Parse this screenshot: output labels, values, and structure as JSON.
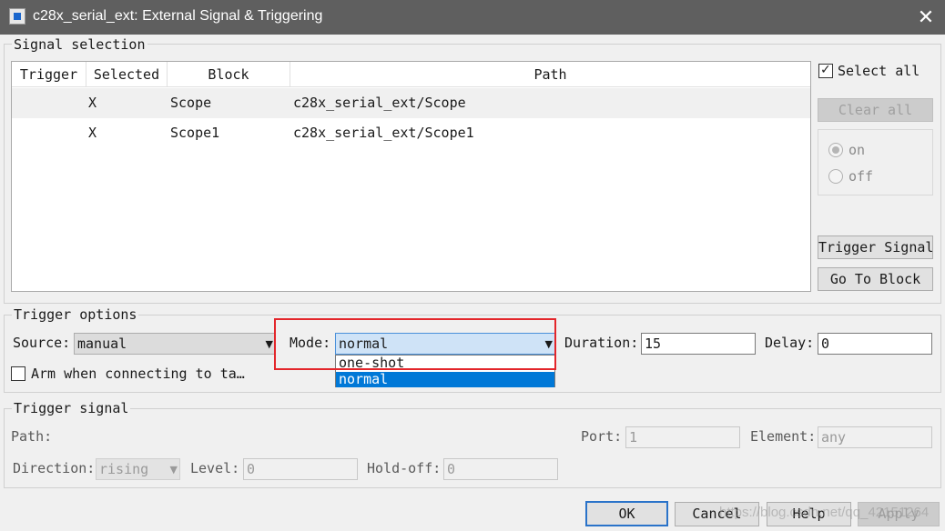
{
  "window": {
    "title": "c28x_serial_ext: External Signal & Triggering",
    "close_label": "✕"
  },
  "signal_selection": {
    "label": "Signal selection",
    "columns": [
      "Trigger",
      "Selected",
      "Block",
      "Path"
    ],
    "rows": [
      {
        "trigger": "",
        "selected": "X",
        "block": "Scope",
        "path": "c28x_serial_ext/Scope"
      },
      {
        "trigger": "",
        "selected": "X",
        "block": "Scope1",
        "path": "c28x_serial_ext/Scope1"
      }
    ],
    "select_all_label": "Select all",
    "clear_all_label": "Clear all",
    "radio_on_label": "on",
    "radio_off_label": "off",
    "trigger_signal_label": "Trigger Signal",
    "go_to_block_label": "Go To Block"
  },
  "trigger_options": {
    "label": "Trigger options",
    "source_label": "Source:",
    "source_value": "manual",
    "mode_label": "Mode:",
    "mode_value": "normal",
    "mode_options": [
      "one-shot",
      "normal"
    ],
    "duration_label": "Duration:",
    "duration_value": "15",
    "delay_label": "Delay:",
    "delay_value": "0",
    "arm_label": "Arm when connecting to ta…"
  },
  "trigger_signal": {
    "label": "Trigger signal",
    "path_label": "Path:",
    "port_label": "Port:",
    "port_value": "1",
    "element_label": "Element:",
    "element_value": "any",
    "direction_label": "Direction:",
    "direction_value": "rising",
    "level_label": "Level:",
    "level_value": "0",
    "holdoff_label": "Hold-off:",
    "holdoff_value": "0"
  },
  "footer": {
    "ok_label": "OK",
    "cancel_label": "Cancel",
    "help_label": "Help",
    "apply_label": "Apply"
  },
  "watermark": "https://blog.csdn.net/qq_42151264",
  "colors": {
    "highlight": "#e3262b",
    "selection": "#0078d7",
    "titlebar": "#5f5f5f"
  }
}
